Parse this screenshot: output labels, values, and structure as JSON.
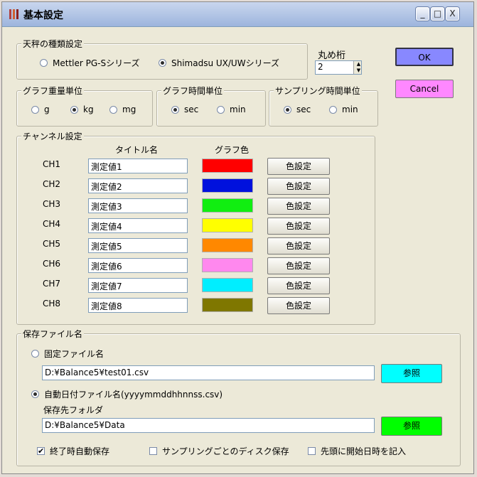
{
  "window": {
    "title": "基本設定",
    "controls": {
      "minimize": "_",
      "maximize": "□",
      "close": "X"
    }
  },
  "balance_type": {
    "label": "天秤の種類設定",
    "options": [
      "Mettler PG-Sシリーズ",
      "Shimadsu UX/UWシリーズ"
    ],
    "selected": "Shimadsu UX/UWシリーズ"
  },
  "rounding": {
    "label": "丸め桁",
    "value": "2"
  },
  "buttons": {
    "ok": "OK",
    "cancel": "Cancel"
  },
  "weight_unit": {
    "label": "グラフ重量単位",
    "options": [
      "g",
      "kg",
      "mg"
    ],
    "selected": "kg"
  },
  "graph_time_unit": {
    "label": "グラフ時間単位",
    "options": [
      "sec",
      "min"
    ],
    "selected": "sec"
  },
  "sampling_time_unit": {
    "label": "サンプリング時間単位",
    "options": [
      "sec",
      "min"
    ],
    "selected": "sec"
  },
  "channels": {
    "label": "チャンネル設定",
    "title_header": "タイトル名",
    "color_header": "グラフ色",
    "set_color_label": "色設定",
    "rows": [
      {
        "ch": "CH1",
        "title": "測定値1",
        "color": "#ff0000"
      },
      {
        "ch": "CH2",
        "title": "測定値2",
        "color": "#0011dd"
      },
      {
        "ch": "CH3",
        "title": "測定値3",
        "color": "#11ee11"
      },
      {
        "ch": "CH4",
        "title": "測定値4",
        "color": "#ffff00"
      },
      {
        "ch": "CH5",
        "title": "測定値5",
        "color": "#ff8800"
      },
      {
        "ch": "CH6",
        "title": "測定値6",
        "color": "#ff88ee"
      },
      {
        "ch": "CH7",
        "title": "測定値7",
        "color": "#00eeff"
      },
      {
        "ch": "CH8",
        "title": "測定値8",
        "color": "#7f7700"
      }
    ]
  },
  "save_file": {
    "label": "保存ファイル名",
    "fixed_option": "固定ファイル名",
    "fixed_path": "D:¥Balance5¥test01.csv",
    "auto_option": "自動日付ファイル名(yyyymmddhhnnss.csv)",
    "folder_label": "保存先フォルダ",
    "folder_path": "D:¥Balance5¥Data",
    "browse_label": "参照",
    "selected": "auto",
    "checks": [
      {
        "label": "終了時自動保存",
        "checked": true
      },
      {
        "label": "サンプリングごとのディスク保存",
        "checked": false
      },
      {
        "label": "先頭に開始日時を記入",
        "checked": false
      }
    ]
  },
  "colors": {
    "ok_button": "#8888ff",
    "cancel_button": "#ff88ff",
    "browse_fixed": "#00ffff",
    "browse_folder": "#00ff00"
  }
}
